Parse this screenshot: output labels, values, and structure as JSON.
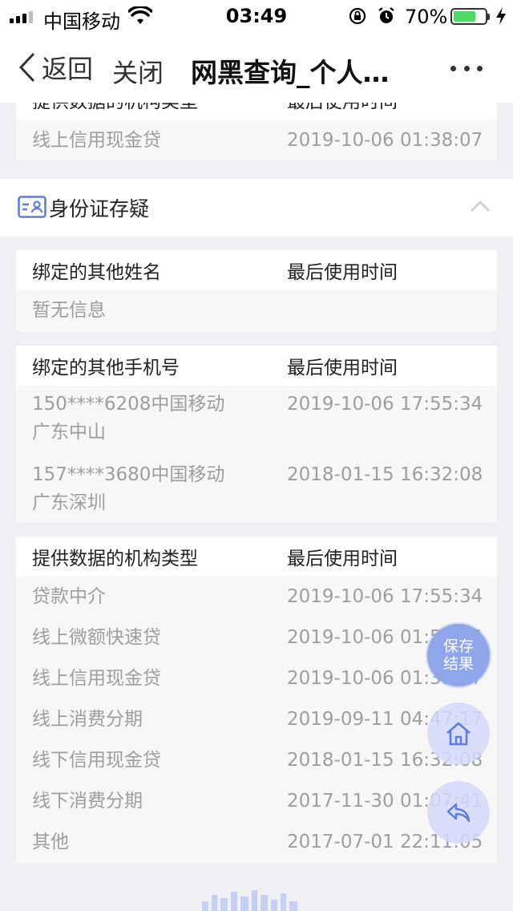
{
  "status_bar": {
    "carrier": "中国移动",
    "time": "03:49",
    "battery_percent": "70%",
    "battery_level": 0.7,
    "icons": [
      "signal-icon",
      "wifi-icon",
      "rotation-lock-icon",
      "alarm-icon",
      "battery-icon",
      "charging-icon"
    ]
  },
  "nav": {
    "back_label": "返回",
    "close_label": "关闭",
    "title": "网黑查询_个人…",
    "more_icon": "more-icon"
  },
  "top_card": {
    "header_col1": "提供数据的机构类型",
    "header_col2": "最后使用时间",
    "row": {
      "type": "线上信用现金贷",
      "time": "2019-10-06 01:38:07"
    }
  },
  "section": {
    "icon": "id-card-icon",
    "title": "身份证存疑",
    "toggle_icon": "chevron-up-icon"
  },
  "table_names": {
    "header_col1": "绑定的其他姓名",
    "header_col2": "最后使用时间",
    "empty_text": "暂无信息"
  },
  "table_phones": {
    "header_col1": "绑定的其他手机号",
    "header_col2": "最后使用时间",
    "rows": [
      {
        "line1": "150****6208中国移动",
        "line2": "广东中山",
        "time": "2019-10-06 17:55:34"
      },
      {
        "line1": "157****3680中国移动",
        "line2": "广东深圳",
        "time": "2018-01-15 16:32:08"
      }
    ]
  },
  "table_orgs": {
    "header_col1": "提供数据的机构类型",
    "header_col2": "最后使用时间",
    "rows": [
      {
        "type": "贷款中介",
        "time": "2019-10-06 17:55:34"
      },
      {
        "type": "线上微额快速贷",
        "time": "2019-10-06 01:52:24"
      },
      {
        "type": "线上信用现金贷",
        "time": "2019-10-06 01:38:07"
      },
      {
        "type": "线上消费分期",
        "time": "2019-09-11 04:47:17"
      },
      {
        "type": "线下信用现金贷",
        "time": "2018-01-15 16:32:08"
      },
      {
        "type": "线下消费分期",
        "time": "2017-11-30 01:07:41"
      },
      {
        "type": "其他",
        "time": "2017-07-01 22:11:05"
      }
    ]
  },
  "fab": {
    "save_label": "保存结果",
    "home_icon": "home-icon",
    "back_icon": "reply-icon"
  },
  "colors": {
    "accent": "#8fa6ea",
    "fab_light": "#d4dafa",
    "battery_green": "#4cd964",
    "text_primary": "#222222",
    "text_secondary": "#9e9e9e",
    "background": "#efeff4"
  }
}
